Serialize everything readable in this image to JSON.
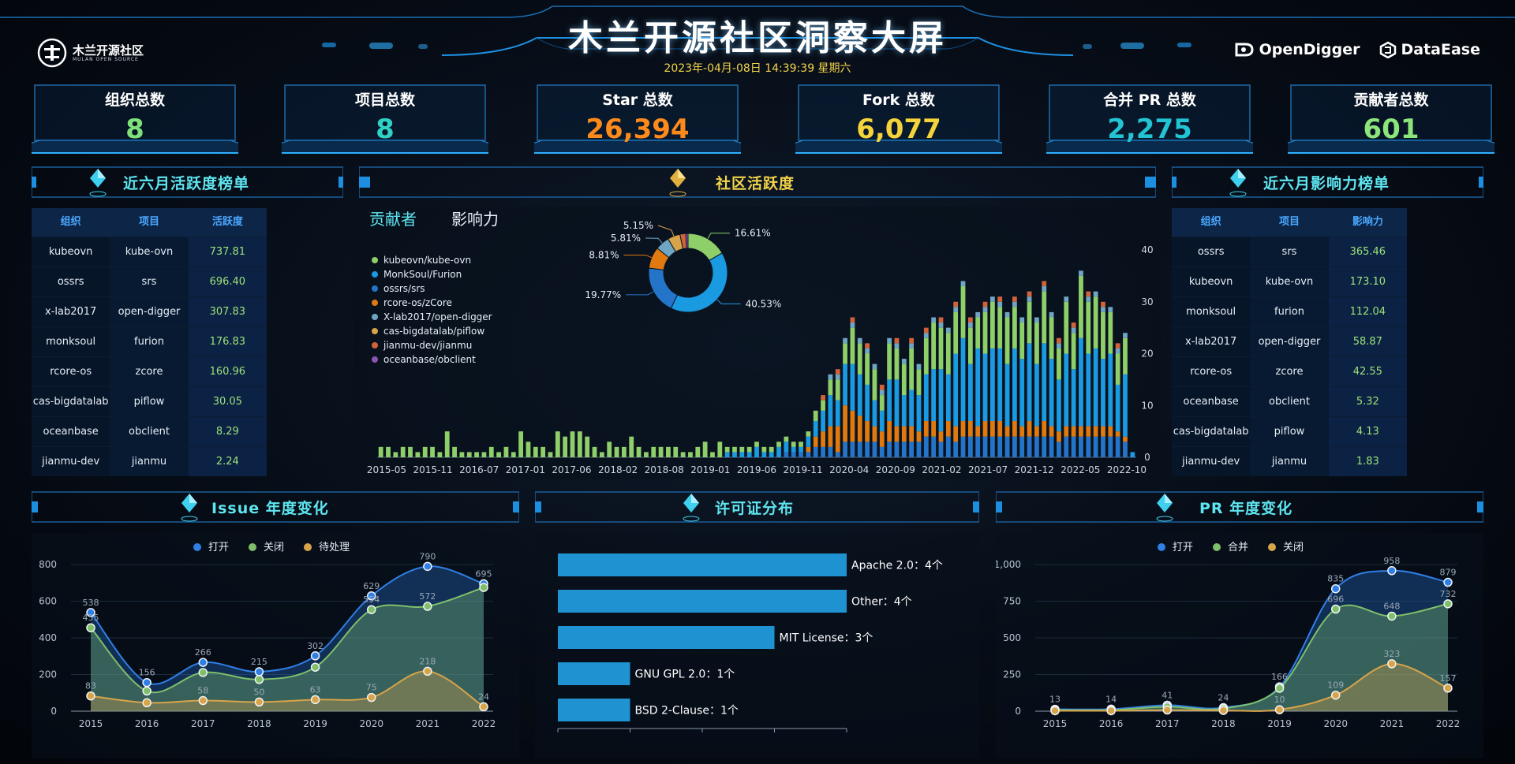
{
  "header": {
    "title": "木兰开源社区洞察大屏",
    "datetime": "2023年-04月-08日 14:39:39 星期六",
    "logo_text": "木兰开源社区",
    "logo_sub": "MULAN OPEN SOURCE",
    "partners": [
      "OpenDigger",
      "DataEase"
    ]
  },
  "kpis": [
    {
      "label": "组织总数",
      "value": "8",
      "color": "#7fe07a"
    },
    {
      "label": "项目总数",
      "value": "8",
      "color": "#2fd1c4"
    },
    {
      "label": "Star 总数",
      "value": "26,394",
      "color": "#ff8a1c"
    },
    {
      "label": "Fork 总数",
      "value": "6,077",
      "color": "#f5d33a"
    },
    {
      "label": "合并 PR 总数",
      "value": "2,275",
      "color": "#22c3d3"
    },
    {
      "label": "贡献者总数",
      "value": "601",
      "color": "#8de47a"
    }
  ],
  "sections": {
    "activity_rank": "近六月活跃度榜单",
    "community": "社区活跃度",
    "influence_rank": "近六月影响力榜单",
    "issue": "Issue 年度变化",
    "license": "许可证分布",
    "pr": "PR 年度变化"
  },
  "activity_table": {
    "headers": [
      "组织",
      "项目",
      "活跃度"
    ],
    "rows": [
      [
        "kubeovn",
        "kube-ovn",
        "737.81"
      ],
      [
        "ossrs",
        "srs",
        "696.40"
      ],
      [
        "x-lab2017",
        "open-digger",
        "307.83"
      ],
      [
        "monksoul",
        "furion",
        "176.83"
      ],
      [
        "rcore-os",
        "zcore",
        "160.96"
      ],
      [
        "cas-bigdatalab",
        "piflow",
        "30.05"
      ],
      [
        "oceanbase",
        "obclient",
        "8.29"
      ],
      [
        "jianmu-dev",
        "jianmu",
        "2.24"
      ]
    ]
  },
  "influence_table": {
    "headers": [
      "组织",
      "项目",
      "影响力"
    ],
    "rows": [
      [
        "ossrs",
        "srs",
        "365.46"
      ],
      [
        "kubeovn",
        "kube-ovn",
        "173.10"
      ],
      [
        "monksoul",
        "furion",
        "112.04"
      ],
      [
        "x-lab2017",
        "open-digger",
        "58.87"
      ],
      [
        "rcore-os",
        "zcore",
        "42.55"
      ],
      [
        "oceanbase",
        "obclient",
        "5.32"
      ],
      [
        "cas-bigdatalab",
        "piflow",
        "4.13"
      ],
      [
        "jianmu-dev",
        "jianmu",
        "1.83"
      ]
    ]
  },
  "community_tabs": [
    "贡献者",
    "影响力"
  ],
  "chart_data": [
    {
      "type": "pie",
      "name": "community-donut",
      "labels": [
        "kubeovn/kube-ovn",
        "MonkSoul/Furion",
        "ossrs/srs",
        "rcore-os/zCore",
        "X-lab2017/open-digger",
        "cas-bigdatalab/piflow",
        "jianmu-dev/jianmu",
        "oceanbase/obclient"
      ],
      "values": [
        16.61,
        40.53,
        19.77,
        8.81,
        5.81,
        5.15,
        2.4,
        0.92
      ],
      "value_labels": [
        "16.61%",
        "40.53%",
        "19.77%",
        "8.81%",
        "5.81%",
        "5.15%",
        "",
        ""
      ],
      "colors": [
        "#8fcf6a",
        "#1a9ae0",
        "#2475c9",
        "#e07a10",
        "#6fa6c4",
        "#d8a44a",
        "#d1633a",
        "#8a56b0"
      ],
      "legend": "left"
    },
    {
      "type": "bar",
      "name": "community-stacked",
      "x_ticks": [
        "2015-05",
        "2015-11",
        "2016-07",
        "2017-01",
        "2017-06",
        "2018-02",
        "2018-08",
        "2019-01",
        "2019-06",
        "2019-11",
        "2020-04",
        "2020-09",
        "2021-02",
        "2021-07",
        "2021-12",
        "2022-05",
        "2022-10"
      ],
      "ylim": [
        0,
        40
      ],
      "y_ticks": [
        0,
        10,
        20,
        30,
        40
      ],
      "series": [
        {
          "name": "kubeovn/kube-ovn",
          "values": [
            0,
            0,
            0,
            0,
            0,
            0,
            0,
            0,
            0,
            0,
            0,
            0,
            0,
            0,
            0,
            0,
            0,
            0,
            0,
            0,
            0,
            0,
            0,
            0,
            0,
            0,
            0,
            0,
            0,
            0,
            0,
            0,
            0,
            0,
            0,
            0,
            0,
            0,
            0,
            0,
            0,
            0,
            0,
            0,
            0,
            0,
            0,
            1,
            1,
            1,
            1,
            2,
            1,
            1,
            2,
            2,
            1,
            1,
            2,
            3,
            4,
            6,
            5,
            8,
            9,
            8,
            7,
            5,
            4,
            8,
            9,
            6,
            7,
            7,
            9,
            10,
            12,
            9,
            14,
            16,
            11,
            15,
            13,
            14,
            14,
            12,
            14,
            13,
            15,
            12,
            15,
            13,
            10,
            14,
            11,
            17,
            14,
            15,
            13,
            14,
            9,
            12,
            1
          ]
        },
        {
          "name": "MonkSoul/Furion",
          "values": [
            2,
            2,
            1,
            2,
            2,
            1,
            2,
            2,
            1,
            5,
            2,
            1,
            1,
            1,
            1,
            2,
            1,
            2,
            1,
            5,
            3,
            2,
            2,
            1,
            5,
            4,
            5,
            5,
            4,
            2,
            1,
            3,
            2,
            2,
            4,
            2,
            1,
            2,
            2,
            2,
            2,
            1,
            1,
            2,
            3,
            1,
            3,
            1,
            1,
            1,
            1,
            1,
            1,
            1,
            1,
            1,
            1,
            1,
            1,
            2,
            2,
            3,
            4,
            4,
            7,
            6,
            6,
            6,
            3,
            7,
            6,
            6,
            8,
            5,
            7,
            9,
            8,
            8,
            8,
            10,
            7,
            6,
            8,
            9,
            8,
            9,
            8,
            7,
            8,
            8,
            10,
            8,
            6,
            10,
            7,
            12,
            10,
            10,
            9,
            8,
            6,
            7,
            0
          ]
        },
        {
          "name": "ossrs/srs",
          "values": [
            0,
            0,
            0,
            0,
            0,
            0,
            0,
            0,
            0,
            0,
            0,
            0,
            0,
            0,
            0,
            0,
            0,
            0,
            0,
            0,
            0,
            0,
            0,
            0,
            0,
            0,
            0,
            0,
            0,
            0,
            0,
            0,
            0,
            0,
            0,
            0,
            0,
            0,
            0,
            0,
            0,
            0,
            0,
            0,
            0,
            0,
            0,
            0,
            0,
            0,
            0,
            0,
            0,
            0,
            0,
            1,
            1,
            1,
            1,
            2,
            2,
            2,
            1,
            3,
            3,
            3,
            3,
            3,
            2,
            3,
            3,
            3,
            3,
            3,
            4,
            4,
            3,
            4,
            3,
            4,
            4,
            4,
            4,
            4,
            4,
            4,
            4,
            4,
            4,
            4,
            4,
            4,
            3,
            4,
            4,
            4,
            4,
            4,
            4,
            4,
            4,
            3,
            0
          ]
        },
        {
          "name": "rcore-os/zCore",
          "values": [
            0,
            0,
            0,
            0,
            0,
            0,
            0,
            0,
            0,
            0,
            0,
            0,
            0,
            0,
            0,
            0,
            0,
            0,
            0,
            0,
            0,
            0,
            0,
            0,
            0,
            0,
            0,
            0,
            0,
            0,
            0,
            0,
            0,
            0,
            0,
            0,
            0,
            0,
            0,
            0,
            0,
            0,
            0,
            0,
            0,
            0,
            0,
            0,
            0,
            0,
            0,
            0,
            0,
            0,
            0,
            0,
            0,
            0,
            1,
            2,
            3,
            4,
            5,
            7,
            6,
            5,
            4,
            3,
            3,
            4,
            3,
            3,
            3,
            2,
            3,
            3,
            2,
            3,
            3,
            3,
            3,
            2,
            3,
            3,
            3,
            2,
            3,
            2,
            3,
            2,
            3,
            2,
            2,
            2,
            2,
            2,
            2,
            2,
            2,
            2,
            1,
            1,
            0
          ]
        },
        {
          "name": "X-lab2017/open-digger",
          "values": [
            0,
            0,
            0,
            0,
            0,
            0,
            0,
            0,
            0,
            0,
            0,
            0,
            0,
            0,
            0,
            0,
            0,
            0,
            0,
            0,
            0,
            0,
            0,
            0,
            0,
            0,
            0,
            0,
            0,
            0,
            0,
            0,
            0,
            0,
            0,
            0,
            0,
            0,
            0,
            0,
            0,
            0,
            0,
            0,
            0,
            0,
            0,
            0,
            0,
            0,
            0,
            0,
            0,
            0,
            0,
            0,
            0,
            0,
            0,
            0,
            0,
            1,
            1,
            1,
            1,
            1,
            1,
            1,
            1,
            1,
            1,
            1,
            1,
            1,
            1,
            1,
            1,
            1,
            1,
            1,
            1,
            1,
            1,
            1,
            1,
            1,
            1,
            1,
            1,
            1,
            1,
            1,
            1,
            1,
            1,
            1,
            1,
            1,
            1,
            1,
            1,
            1,
            0
          ]
        },
        {
          "name": "cas-bigdatalab/piflow",
          "values": [
            0,
            0,
            0,
            0,
            0,
            0,
            0,
            0,
            0,
            0,
            0,
            0,
            0,
            0,
            0,
            0,
            0,
            0,
            0,
            0,
            0,
            0,
            0,
            0,
            0,
            0,
            0,
            0,
            0,
            0,
            0,
            0,
            0,
            0,
            0,
            0,
            0,
            0,
            0,
            0,
            0,
            0,
            0,
            0,
            0,
            0,
            0,
            0,
            0,
            0,
            0,
            0,
            0,
            0,
            0,
            0,
            0,
            0,
            0,
            0,
            1,
            0,
            1,
            0,
            1,
            0,
            1,
            0,
            1,
            0,
            1,
            0,
            1,
            0,
            1,
            0,
            1,
            0,
            1,
            0,
            1,
            0,
            1,
            0,
            1,
            0,
            1,
            0,
            1,
            0,
            1,
            0,
            1,
            0,
            1,
            0,
            1,
            0,
            1,
            0,
            1,
            0,
            0
          ]
        }
      ]
    },
    {
      "type": "area",
      "name": "issue-yearly",
      "categories": [
        "2015",
        "2016",
        "2017",
        "2018",
        "2019",
        "2020",
        "2021",
        "2022"
      ],
      "ylim": [
        0,
        800
      ],
      "y_ticks": [
        0,
        200,
        400,
        600,
        800
      ],
      "series": [
        {
          "name": "打开",
          "values": [
            538,
            156,
            266,
            215,
            302,
            629,
            790,
            695
          ],
          "color": "#2f7fe6"
        },
        {
          "name": "关闭",
          "values": [
            455,
            110,
            211,
            173,
            240,
            554,
            572,
            675
          ],
          "color": "#7fbf6a"
        },
        {
          "name": "待处理",
          "values": [
            83,
            46,
            58,
            50,
            63,
            75,
            218,
            24
          ],
          "color": "#d8a44a"
        }
      ],
      "labels": {
        "打开": [
          "538",
          "156",
          "266",
          "215",
          "302",
          "629",
          "790",
          "695"
        ],
        "关闭": [
          "455",
          "",
          "",
          "",
          "",
          "554",
          "572",
          ""
        ],
        "待处理": [
          "83",
          "",
          "58",
          "50",
          "63",
          "75",
          "218",
          "24"
        ]
      },
      "legend": "top"
    },
    {
      "type": "bar",
      "name": "license-distribution",
      "orientation": "horizontal",
      "categories": [
        "Apache 2.0：4个",
        "Other：4个",
        "MIT License：3个",
        "GNU GPL 2.0：1个",
        "BSD 2-Clause：1个"
      ],
      "values": [
        4,
        4,
        3,
        1,
        1
      ],
      "xlim": [
        0,
        4
      ],
      "color": "#1f93d1"
    },
    {
      "type": "area",
      "name": "pr-yearly",
      "categories": [
        "2015",
        "2016",
        "2017",
        "2018",
        "2019",
        "2020",
        "2021",
        "2022"
      ],
      "ylim": [
        0,
        1000
      ],
      "y_ticks": [
        "0",
        "250",
        "500",
        "750",
        "1,000"
      ],
      "y_tick_values": [
        0,
        250,
        500,
        750,
        1000
      ],
      "series": [
        {
          "name": "打开",
          "values": [
            13,
            14,
            41,
            24,
            166,
            835,
            958,
            879
          ],
          "color": "#2f7fe6"
        },
        {
          "name": "合并",
          "values": [
            8,
            8,
            30,
            18,
            156,
            696,
            648,
            732
          ],
          "color": "#7fbf6a"
        },
        {
          "name": "关闭",
          "values": [
            3,
            3,
            8,
            5,
            10,
            109,
            323,
            157
          ],
          "color": "#d8a44a"
        }
      ],
      "labels": {
        "打开": [
          "13",
          "14",
          "41",
          "24",
          "166",
          "835",
          "958",
          "879"
        ],
        "合并": [
          "",
          "",
          "",
          "",
          "",
          "696",
          "648",
          "732"
        ],
        "关闭": [
          "",
          "",
          "",
          "",
          "10",
          "109",
          "323",
          "157"
        ]
      },
      "legend": "top"
    }
  ]
}
